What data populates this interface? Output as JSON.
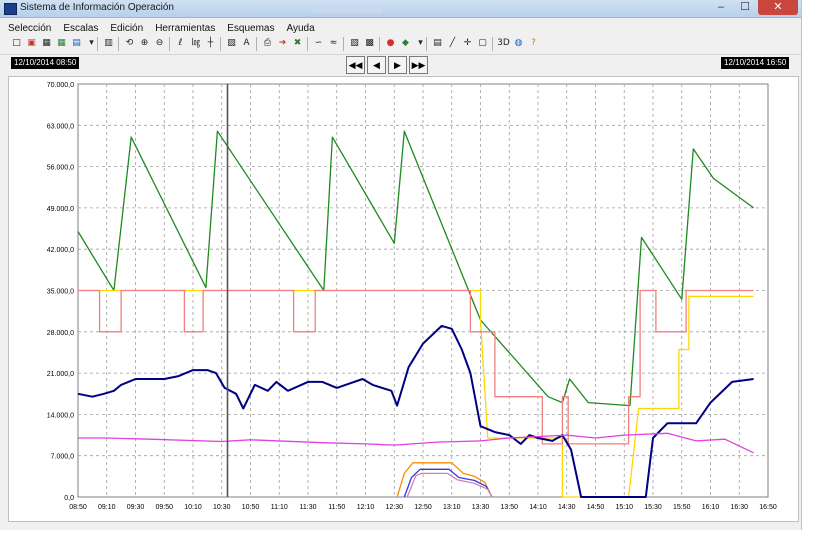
{
  "window": {
    "title": "Sistema de Información Operación"
  },
  "menu": [
    "Selección",
    "Escalas",
    "Edición",
    "Herramientas",
    "Esquemas",
    "Ayuda"
  ],
  "toolbar_icons": [
    "new-icon",
    "chart-icon",
    "grid-icon",
    "grid-color-icon",
    "grid-blue-icon",
    "dropdown-arrow-icon",
    "bar-icon",
    "zoom-reset-icon",
    "zoom-in-icon",
    "zoom-out-icon",
    "linear-scale-icon",
    "log-scale-icon",
    "crosshair-icon",
    "save-icon",
    "text-icon",
    "print-icon",
    "export-icon",
    "excel-icon",
    "curve-icon",
    "wave-icon",
    "filter-icon",
    "filter-off-icon",
    "record-icon",
    "series-color-icon",
    "dropdown-arrow-icon",
    "table-icon",
    "line-tool-icon",
    "cursor-cross-icon",
    "window-icon",
    "3d-icon",
    "globe-icon",
    "help-icon"
  ],
  "navigation": {
    "start_time": "12/10/2014 08:50",
    "end_time": "12/10/2014 16:50",
    "first_label": "◀◀",
    "prev_label": "◀",
    "next_label": "▶",
    "last_label": "▶▶"
  },
  "chart_data": {
    "type": "line",
    "ylim": [
      0,
      70000
    ],
    "yticks": [
      "0,0",
      "7.000,0",
      "14.000,0",
      "21.000,0",
      "28.000,0",
      "35.000,0",
      "42.000,0",
      "49.000,0",
      "56.000,0",
      "63.000,0",
      "70.000,0"
    ],
    "xticks": [
      "08:50",
      "09:10",
      "09:30",
      "09:50",
      "10:10",
      "10:30",
      "10:50",
      "11:10",
      "11:30",
      "11:50",
      "12:10",
      "12:30",
      "12:50",
      "13:10",
      "13:30",
      "13:50",
      "14:10",
      "14:30",
      "14:50",
      "15:10",
      "15:30",
      "15:50",
      "16:10",
      "16:30",
      "16:50"
    ],
    "x_minutes_range": [
      530,
      1010
    ],
    "grid": true,
    "cursor_x": "10:34",
    "series": [
      {
        "color": "#1f8a1f",
        "points": [
          [
            530,
            45000
          ],
          [
            555,
            35000
          ],
          [
            567,
            61000
          ],
          [
            619,
            35500
          ],
          [
            627,
            62000
          ],
          [
            701,
            35000
          ],
          [
            707,
            61000
          ],
          [
            750,
            43000
          ],
          [
            757,
            62000
          ],
          [
            810,
            30000
          ],
          [
            857,
            17000
          ],
          [
            867,
            16000
          ],
          [
            872,
            20000
          ],
          [
            885,
            16000
          ],
          [
            914,
            15500
          ],
          [
            922,
            44000
          ],
          [
            950,
            33500
          ],
          [
            958,
            59000
          ],
          [
            972,
            54000
          ],
          [
            1000,
            49000
          ]
        ]
      },
      {
        "color": "#ffd700",
        "points": [
          [
            530,
            35000
          ],
          [
            810,
            35000
          ],
          [
            810,
            30000
          ],
          [
            815,
            10000
          ],
          [
            867,
            10000
          ],
          [
            867,
            0
          ],
          [
            913,
            0
          ],
          [
            920,
            15000
          ],
          [
            948,
            15000
          ],
          [
            948,
            25000
          ],
          [
            955,
            25000
          ],
          [
            955,
            34000
          ],
          [
            1000,
            34000
          ]
        ]
      },
      {
        "color": "#f08080",
        "points": [
          [
            530,
            35000
          ],
          [
            545,
            35000
          ],
          [
            545,
            28000
          ],
          [
            560,
            28000
          ],
          [
            560,
            35000
          ],
          [
            604,
            35000
          ],
          [
            604,
            28000
          ],
          [
            617,
            28000
          ],
          [
            617,
            35000
          ],
          [
            680,
            35000
          ],
          [
            680,
            28000
          ],
          [
            695,
            28000
          ],
          [
            695,
            35000
          ],
          [
            803,
            35000
          ],
          [
            803,
            28000
          ],
          [
            820,
            28000
          ],
          [
            820,
            17000
          ],
          [
            853,
            17000
          ],
          [
            853,
            9000
          ],
          [
            867,
            9000
          ],
          [
            867,
            17000
          ],
          [
            871,
            17000
          ],
          [
            871,
            9000
          ],
          [
            913,
            9000
          ],
          [
            913,
            17000
          ],
          [
            921,
            17000
          ],
          [
            921,
            35000
          ],
          [
            932,
            35000
          ],
          [
            932,
            28000
          ],
          [
            953,
            28000
          ],
          [
            953,
            35000
          ],
          [
            1000,
            35000
          ]
        ]
      },
      {
        "color": "#000080",
        "points": [
          [
            530,
            17500
          ],
          [
            540,
            17000
          ],
          [
            548,
            17500
          ],
          [
            555,
            18000
          ],
          [
            560,
            19000
          ],
          [
            570,
            20000
          ],
          [
            590,
            20000
          ],
          [
            600,
            20500
          ],
          [
            610,
            21500
          ],
          [
            620,
            21500
          ],
          [
            626,
            21000
          ],
          [
            632,
            18500
          ],
          [
            640,
            17500
          ],
          [
            645,
            15000
          ],
          [
            653,
            19000
          ],
          [
            662,
            18000
          ],
          [
            668,
            19500
          ],
          [
            676,
            18000
          ],
          [
            690,
            19500
          ],
          [
            700,
            19500
          ],
          [
            710,
            18500
          ],
          [
            728,
            20000
          ],
          [
            735,
            19000
          ],
          [
            748,
            18000
          ],
          [
            752,
            15500
          ],
          [
            760,
            22000
          ],
          [
            770,
            26000
          ],
          [
            783,
            29000
          ],
          [
            790,
            28500
          ],
          [
            797,
            25000
          ],
          [
            803,
            21000
          ],
          [
            810,
            12000
          ],
          [
            820,
            11000
          ],
          [
            830,
            10500
          ],
          [
            838,
            9000
          ],
          [
            844,
            10500
          ],
          [
            850,
            10000
          ],
          [
            860,
            9500
          ],
          [
            867,
            10500
          ],
          [
            873,
            8000
          ],
          [
            880,
            0
          ],
          [
            925,
            0
          ],
          [
            930,
            10000
          ],
          [
            940,
            12500
          ],
          [
            960,
            12500
          ],
          [
            970,
            16000
          ],
          [
            985,
            19500
          ],
          [
            1000,
            20000
          ]
        ]
      },
      {
        "color": "#e040e0",
        "points": [
          [
            530,
            10000
          ],
          [
            550,
            10000
          ],
          [
            580,
            9800
          ],
          [
            630,
            9400
          ],
          [
            650,
            9700
          ],
          [
            700,
            9200
          ],
          [
            730,
            9000
          ],
          [
            750,
            8800
          ],
          [
            780,
            9300
          ],
          [
            810,
            9500
          ],
          [
            830,
            10000
          ],
          [
            870,
            10500
          ],
          [
            890,
            10000
          ],
          [
            910,
            10500
          ],
          [
            940,
            10800
          ],
          [
            960,
            9500
          ],
          [
            980,
            9800
          ],
          [
            1000,
            7500
          ]
        ]
      },
      {
        "color": "#ff8c00",
        "points": [
          [
            752,
            0
          ],
          [
            757,
            4000
          ],
          [
            763,
            5800
          ],
          [
            790,
            5800
          ],
          [
            798,
            4000
          ],
          [
            806,
            3500
          ],
          [
            813,
            2500
          ],
          [
            818,
            0
          ]
        ]
      },
      {
        "color": "#3a3ad0",
        "points": [
          [
            757,
            0
          ],
          [
            762,
            3300
          ],
          [
            768,
            4700
          ],
          [
            788,
            4700
          ],
          [
            795,
            3300
          ],
          [
            806,
            2800
          ],
          [
            814,
            1800
          ],
          [
            818,
            0
          ]
        ]
      },
      {
        "color": "#d080c0",
        "points": [
          [
            759,
            0
          ],
          [
            765,
            3600
          ],
          [
            769,
            4000
          ],
          [
            787,
            4000
          ],
          [
            794,
            2900
          ],
          [
            806,
            2300
          ],
          [
            815,
            1300
          ],
          [
            818,
            0
          ]
        ]
      }
    ]
  }
}
